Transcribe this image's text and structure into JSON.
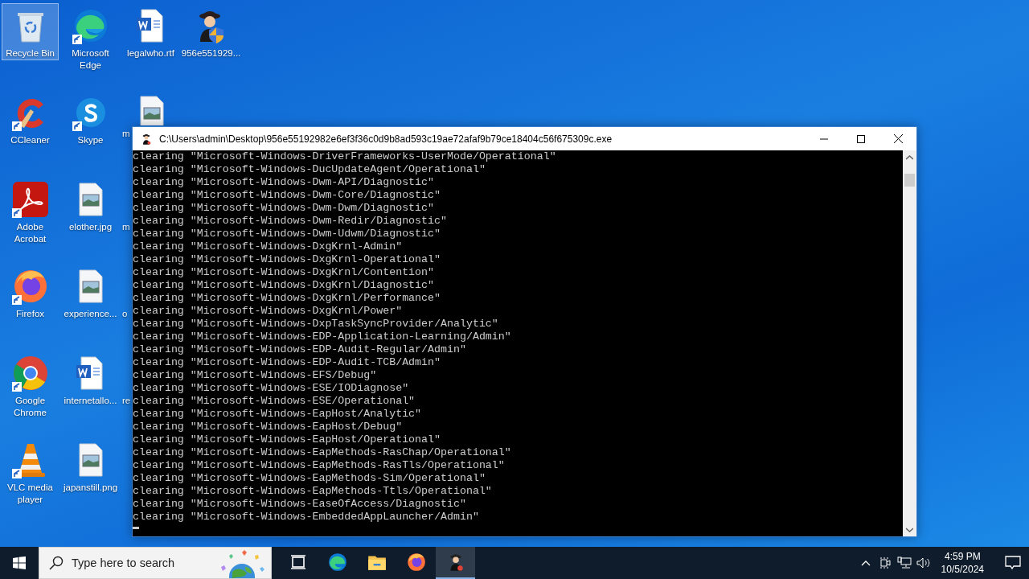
{
  "desktop": {
    "columns": [
      [
        {
          "label": "Recycle Bin",
          "kind": "recycle",
          "shortcut": false,
          "selected": true
        },
        {
          "label": "CCleaner",
          "kind": "ccleaner",
          "shortcut": true,
          "selected": false
        },
        {
          "label": "Adobe Acrobat",
          "kind": "acrobat",
          "shortcut": true,
          "selected": false
        },
        {
          "label": "Firefox",
          "kind": "firefox",
          "shortcut": true,
          "selected": false
        },
        {
          "label": "Google Chrome",
          "kind": "chrome",
          "shortcut": true,
          "selected": false
        },
        {
          "label": "VLC media player",
          "kind": "vlc",
          "shortcut": true,
          "selected": false
        }
      ],
      [
        {
          "label": "Microsoft Edge",
          "kind": "edge",
          "shortcut": true,
          "selected": false
        },
        {
          "label": "Skype",
          "kind": "skype",
          "shortcut": true,
          "selected": false
        },
        {
          "label": "elother.jpg",
          "kind": "image",
          "shortcut": false,
          "selected": false
        },
        {
          "label": "experience...",
          "kind": "image",
          "shortcut": false,
          "selected": false
        },
        {
          "label": "internetallo...",
          "kind": "word",
          "shortcut": false,
          "selected": false
        },
        {
          "label": "japanstill.png",
          "kind": "image",
          "shortcut": false,
          "selected": false
        }
      ],
      [
        {
          "label": "legalwho.rtf",
          "kind": "word",
          "shortcut": false,
          "selected": false
        },
        {
          "label": "m",
          "kind": "image-cut"
        },
        {
          "label": "m",
          "kind": "hidden"
        },
        {
          "label": "o",
          "kind": "hidden"
        },
        {
          "label": "re",
          "kind": "hidden"
        }
      ],
      [
        {
          "label": "956e551929...",
          "kind": "spy",
          "shortcut": false,
          "selected": false
        }
      ]
    ]
  },
  "console": {
    "title": "C:\\Users\\admin\\Desktop\\956e55192982e6ef3f36c0d9b8ad593c19ae72afaf9b79ce18404c56f675309c.exe",
    "lines": [
      "clearing \"Microsoft-Windows-DriverFrameworks-UserMode/Operational\"",
      "clearing \"Microsoft-Windows-DucUpdateAgent/Operational\"",
      "clearing \"Microsoft-Windows-Dwm-API/Diagnostic\"",
      "clearing \"Microsoft-Windows-Dwm-Core/Diagnostic\"",
      "clearing \"Microsoft-Windows-Dwm-Dwm/Diagnostic\"",
      "clearing \"Microsoft-Windows-Dwm-Redir/Diagnostic\"",
      "clearing \"Microsoft-Windows-Dwm-Udwm/Diagnostic\"",
      "clearing \"Microsoft-Windows-DxgKrnl-Admin\"",
      "clearing \"Microsoft-Windows-DxgKrnl-Operational\"",
      "clearing \"Microsoft-Windows-DxgKrnl/Contention\"",
      "clearing \"Microsoft-Windows-DxgKrnl/Diagnostic\"",
      "clearing \"Microsoft-Windows-DxgKrnl/Performance\"",
      "clearing \"Microsoft-Windows-DxgKrnl/Power\"",
      "clearing \"Microsoft-Windows-DxpTaskSyncProvider/Analytic\"",
      "clearing \"Microsoft-Windows-EDP-Application-Learning/Admin\"",
      "clearing \"Microsoft-Windows-EDP-Audit-Regular/Admin\"",
      "clearing \"Microsoft-Windows-EDP-Audit-TCB/Admin\"",
      "clearing \"Microsoft-Windows-EFS/Debug\"",
      "clearing \"Microsoft-Windows-ESE/IODiagnose\"",
      "clearing \"Microsoft-Windows-ESE/Operational\"",
      "clearing \"Microsoft-Windows-EapHost/Analytic\"",
      "clearing \"Microsoft-Windows-EapHost/Debug\"",
      "clearing \"Microsoft-Windows-EapHost/Operational\"",
      "clearing \"Microsoft-Windows-EapMethods-RasChap/Operational\"",
      "clearing \"Microsoft-Windows-EapMethods-RasTls/Operational\"",
      "clearing \"Microsoft-Windows-EapMethods-Sim/Operational\"",
      "clearing \"Microsoft-Windows-EapMethods-Ttls/Operational\"",
      "clearing \"Microsoft-Windows-EaseOfAccess/Diagnostic\"",
      "clearing \"Microsoft-Windows-EmbeddedAppLauncher/Admin\""
    ],
    "cursor": true
  },
  "taskbar": {
    "search": {
      "placeholder": "Type here to search"
    },
    "apps": [
      {
        "kind": "taskview",
        "active": false
      },
      {
        "kind": "edge",
        "active": false
      },
      {
        "kind": "explorer",
        "active": false
      },
      {
        "kind": "firefox",
        "active": false
      },
      {
        "kind": "spy",
        "active": true
      }
    ],
    "time": "4:59 PM",
    "date": "10/5/2024"
  }
}
